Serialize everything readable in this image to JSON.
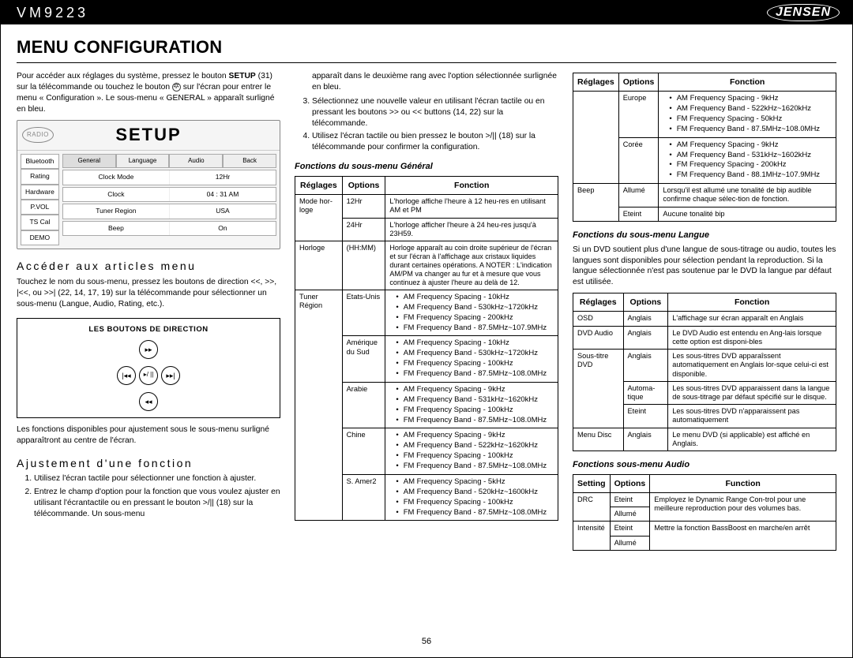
{
  "header": {
    "model": "VM9223",
    "brand": "JENSEN"
  },
  "title": "MENU CONFIGURATION",
  "pagenum": "56",
  "col1": {
    "p1a": "Pour accéder aux réglages du système, pressez le bouton",
    "p1b": "SETUP",
    "p1c": " (31) sur la télécommande ou touchez le bouton ",
    "p1d": " sur l'écran pour entrer le menu « Configuration ». Le sous-menu « GENERAL » apparaît surligné en bleu.",
    "setup": {
      "title": "SETUP",
      "radio": "RADIO",
      "side": [
        "Bluetooth",
        "Rating",
        "Hardware",
        "P.VOL",
        "TS Cal",
        "DEMO"
      ],
      "tabs": [
        "General",
        "Language",
        "Audio",
        "Back"
      ],
      "rows": [
        {
          "k": "Clock Mode",
          "v": "12Hr"
        },
        {
          "k": "Clock",
          "v": "04 : 31  AM"
        },
        {
          "k": "Tuner Region",
          "v": "USA"
        },
        {
          "k": "Beep",
          "v": "On"
        }
      ]
    },
    "sub1": "Accéder aux articles menu",
    "sub1p": "Touchez le nom du sous-menu, pressez les boutons de direction <<, >>, |<<, ou >>| (22, 14, 17, 19) sur la télécommande pour sélectionner un sous-menu (Langue, Audio, Rating, etc.).",
    "dirtitle": "LES BOUTONS DE DIRECTION",
    "dbtns": {
      "up": "▸▸",
      "down": "◂◂",
      "left": "|◂◂",
      "right": "▸▸|",
      "mid": "▸/ ||"
    },
    "sub1p2": "Les fonctions disponibles pour ajustement sous le sous-menu surligné apparaîtront au centre de l'écran.",
    "sub2": "Ajustement d'une fonction",
    "ol": [
      "Utilisez l'écran tactile pour sélectionner une fonction à ajuster.",
      "Entrez le champ d'option pour la fonction que vous voulez ajuster en utilisant l'écrantactile ou en pressant le bouton >/|| (18) sur la télécommande. Un sous-menu"
    ]
  },
  "col2": {
    "p_cont": "apparaît dans le deuxième rang avec l'option sélectionnée surlignée en bleu.",
    "ol": [
      "Sélectionnez une nouvelle valeur en utilisant l'écran tactile ou en pressant les boutons >> ou << buttons (14, 22) sur la télécommande.",
      "Utilisez l'écran tactile ou bien pressez le bouton >/|| (18) sur la télécommande pour confirmer la configuration."
    ],
    "tcap": "Fonctions du sous-menu Général",
    "th": [
      "Réglages",
      "Options",
      "Fonction"
    ],
    "rows": [
      {
        "r": "Mode hor-\nloge",
        "o": "12Hr",
        "f": "L'horloge affiche l'heure à 12 heu-res en utilisant AM et PM"
      },
      {
        "r": "",
        "o": "24Hr",
        "f": "L'horloge afficher l'heure à 24 heu-res jusqu'à 23H59."
      },
      {
        "r": "Horloge",
        "o": "(HH:MM)",
        "f": "Horloge apparaît au coin droite supérieur de l'écran et sur l'écran à l'affichage aux cristaux liquides durant certaines opérations. A NOTER : L'indication AM/PM va changer au fur et à mesure que vous continuez à ajuster l'heure au delà de 12."
      },
      {
        "r": "Tuner Région",
        "o": "Etats-Unis",
        "f": [
          "AM Frequency Spacing - 10kHz",
          "AM Frequency Band - 530kHz~1720kHz",
          "FM Frequency Spacing - 200kHz",
          "FM Frequency Band - 87.5MHz~107.9MHz"
        ]
      },
      {
        "r": "",
        "o": "Amérique du Sud",
        "f": [
          "AM Frequency Spacing - 10kHz",
          "AM Frequency Band - 530kHz~1720kHz",
          "FM Frequency Spacing - 100kHz",
          "FM Frequency Band - 87.5MHz~108.0MHz"
        ]
      },
      {
        "r": "",
        "o": "Arabie",
        "f": [
          "AM Frequency Spacing - 9kHz",
          "AM Frequency Band - 531kHz~1620kHz",
          "FM Frequency Spacing - 100kHz",
          "FM Frequency Band - 87.5MHz~108.0MHz"
        ]
      },
      {
        "r": "",
        "o": "Chine",
        "f": [
          "AM Frequency Spacing - 9kHz",
          "AM Frequency Band - 522kHz~1620kHz",
          "FM Frequency Spacing - 100kHz",
          "FM Frequency Band - 87.5MHz~108.0MHz"
        ]
      },
      {
        "r": "",
        "o": "S. Amer2",
        "f": [
          "AM Frequency Spacing - 5kHz",
          "AM Frequency Band - 520kHz~1600kHz",
          "FM Frequency Spacing - 100kHz",
          "FM Frequency Band - 87.5MHz~108.0MHz"
        ]
      }
    ]
  },
  "col3": {
    "th1": [
      "Réglages",
      "Options",
      "Fonction"
    ],
    "t1": [
      {
        "r": "",
        "o": "Europe",
        "f": [
          "AM Frequency Spacing - 9kHz",
          "AM Frequency Band - 522kHz~1620kHz",
          "FM Frequency Spacing - 50kHz",
          "FM Frequency Band - 87.5MHz~108.0MHz"
        ]
      },
      {
        "r": "",
        "o": "Corée",
        "f": [
          "AM Frequency Spacing - 9kHz",
          "AM Frequency Band - 531kHz~1602kHz",
          "FM Frequency Spacing - 200kHz",
          "FM Frequency Band - 88.1MHz~107.9MHz"
        ]
      },
      {
        "r": "Beep",
        "o": "Allumé",
        "f": "Lorsqu'il est allumé une tonalité de bip audible confirme chaque sélec-tion de fonction."
      },
      {
        "r": "",
        "o": "Eteint",
        "f": "Aucune tonalité bip"
      }
    ],
    "cap2": "Fonctions du sous-menu Langue",
    "p2": "Si un DVD soutient plus d'une langue de sous-titrage ou audio, toutes les langues sont disponibles pour sélection pendant la reproduction. Si la langue sélectionnée n'est pas soutenue par le DVD la langue par défaut est utilisée.",
    "th2": [
      "Réglages",
      "Options",
      "Fonction"
    ],
    "t2": [
      {
        "r": "OSD",
        "o": "Anglais",
        "f": "L'affichage sur écran apparaît en Anglais"
      },
      {
        "r": "DVD Audio",
        "o": "Anglais",
        "f": "Le DVD Audio est entendu en Ang-lais lorsque cette option est disponi-bles"
      },
      {
        "r": "Sous-titre DVD",
        "o": "Anglais",
        "f": "Les sous-titres DVD apparaîssent automatiquement en Anglais lor-sque celui-ci est disponible."
      },
      {
        "r": "",
        "o": "Automa-tique",
        "f": "Les sous-titres DVD apparaissent dans la langue de sous-titrage par défaut spécifié sur le disque."
      },
      {
        "r": "",
        "o": "Eteint",
        "f": "Les sous-titres DVD n'apparaissent pas automatiquement"
      },
      {
        "r": "Menu Disc",
        "o": "Anglais",
        "f": "Le menu DVD (si applicable) est affiché en Anglais."
      }
    ],
    "cap3": "Fonctions sous-menu Audio",
    "th3": [
      "Setting",
      "Options",
      "Function"
    ],
    "t3": [
      {
        "r": "DRC",
        "o": "Eteint",
        "f": "Employez le Dynamic Range Con-trol pour une meilleure reproduction pour des volumes bas."
      },
      {
        "r": "",
        "o": "Allumé",
        "f": ""
      },
      {
        "r": "Intensité",
        "o": "Eteint",
        "f": "Mettre la fonction BassBoost en marche/en arrêt"
      },
      {
        "r": "",
        "o": "Allumé",
        "f": ""
      }
    ]
  }
}
